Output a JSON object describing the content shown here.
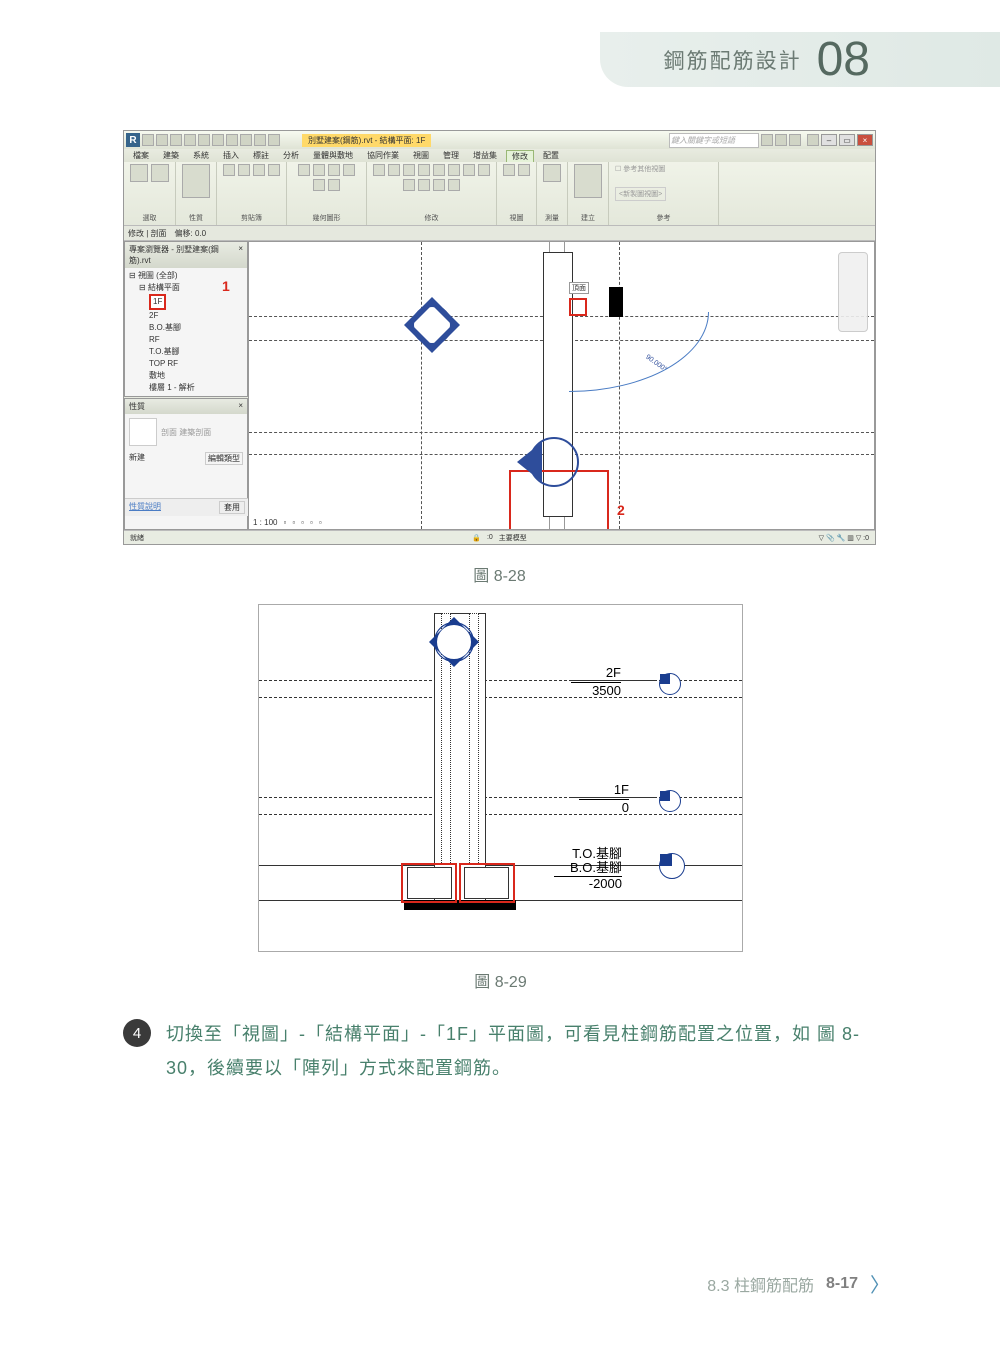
{
  "header": {
    "title": "鋼筋配筋設計",
    "chapter_num": "08"
  },
  "figure1": {
    "caption": "圖 8-28",
    "app": {
      "doc_title": "別墅建案(鋼筋).rvt - 結構平面: 1F",
      "search_placeholder": "鍵入關鍵字或短語",
      "menus": [
        "檔案",
        "建築",
        "系統",
        "插入",
        "標註",
        "分析",
        "量體與敷地",
        "協同作業",
        "視圖",
        "管理",
        "增益集",
        "修改",
        "配置",
        "•"
      ],
      "active_menu": "修改",
      "ribbon_groups": [
        "選取",
        "性質",
        "剪貼簿",
        "幾何圖形",
        "修改",
        "視圖",
        "測量",
        "建立",
        "參考"
      ],
      "ref_checkbox": "參考其他視圖",
      "ref_select": "<新製圖視圖>",
      "subbar_left": "修改 | 剖面",
      "subbar_offset_label": "偏移: 0.0",
      "browser_title": "專案瀏覽器 - 別墅建案(鋼筋).rvt",
      "tree": {
        "root": "視圖 (全部)",
        "group": "結構平面",
        "items": [
          "1F",
          "2F",
          "B.O.基腳",
          "RF",
          "T.O.基腳",
          "TOP RF",
          "敷地",
          "樓層 1 - 解析"
        ]
      },
      "props_title": "性質",
      "props_type": "剖面 建築剖面",
      "props_new": "新建",
      "props_edit": "編輯類型",
      "props_help": "性質說明",
      "props_apply": "套用",
      "scale": "1 : 100",
      "status_left": "就緒",
      "status_right_model": "主要模型",
      "annotation_angle": "90.000°",
      "label1": "1",
      "label2": "2",
      "callout_label": "頂面"
    }
  },
  "figure2": {
    "caption": "圖 8-29",
    "levels": [
      {
        "name": "2F",
        "elev": "3500"
      },
      {
        "name": "1F",
        "elev": "0"
      },
      {
        "name_a": "T.O.基腳",
        "name_b": "B.O.基腳",
        "elev": "-2000"
      }
    ]
  },
  "step": {
    "num": "4",
    "text": "切換至「視圖」-「結構平面」-「1F」平面圖，可看見柱鋼筋配置之位置，如 圖 8-30，後續要以「陣列」方式來配置鋼筋。"
  },
  "footer": {
    "section": "8.3  柱鋼筋配筋",
    "page": "8-17"
  }
}
